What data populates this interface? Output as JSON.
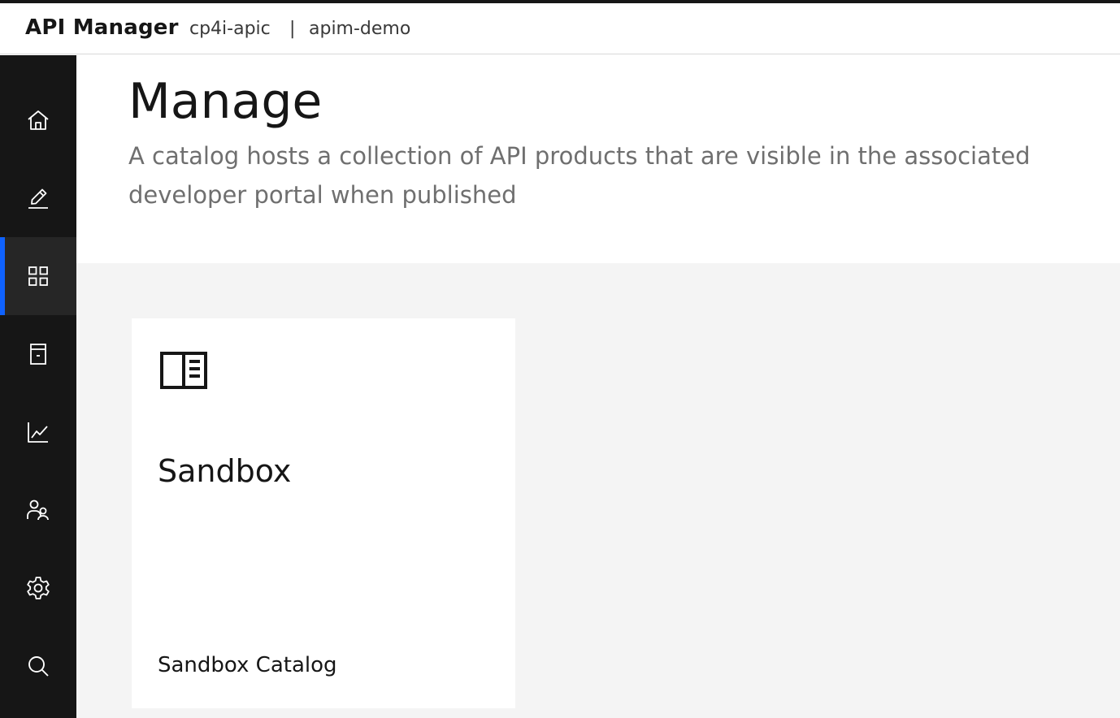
{
  "header": {
    "app_title": "API Manager",
    "org": "cp4i-apic",
    "separator": "|",
    "catalog": "apim-demo"
  },
  "sidebar": {
    "items": [
      {
        "icon": "home-icon"
      },
      {
        "icon": "edit-icon"
      },
      {
        "icon": "grid-icon",
        "active": true
      },
      {
        "icon": "archive-icon"
      },
      {
        "icon": "chart-icon"
      },
      {
        "icon": "users-icon"
      },
      {
        "icon": "gear-icon"
      },
      {
        "icon": "search-icon"
      }
    ]
  },
  "main": {
    "title": "Manage",
    "description": "A catalog hosts a collection of API products that are visible in the associated developer portal when published"
  },
  "catalogs": [
    {
      "name": "Sandbox",
      "description": "Sandbox Catalog",
      "icon": "catalog-icon"
    }
  ],
  "colors": {
    "sidebar_bg": "#161616",
    "active_indicator": "#0f62fe",
    "body_bg": "#f4f4f4"
  }
}
